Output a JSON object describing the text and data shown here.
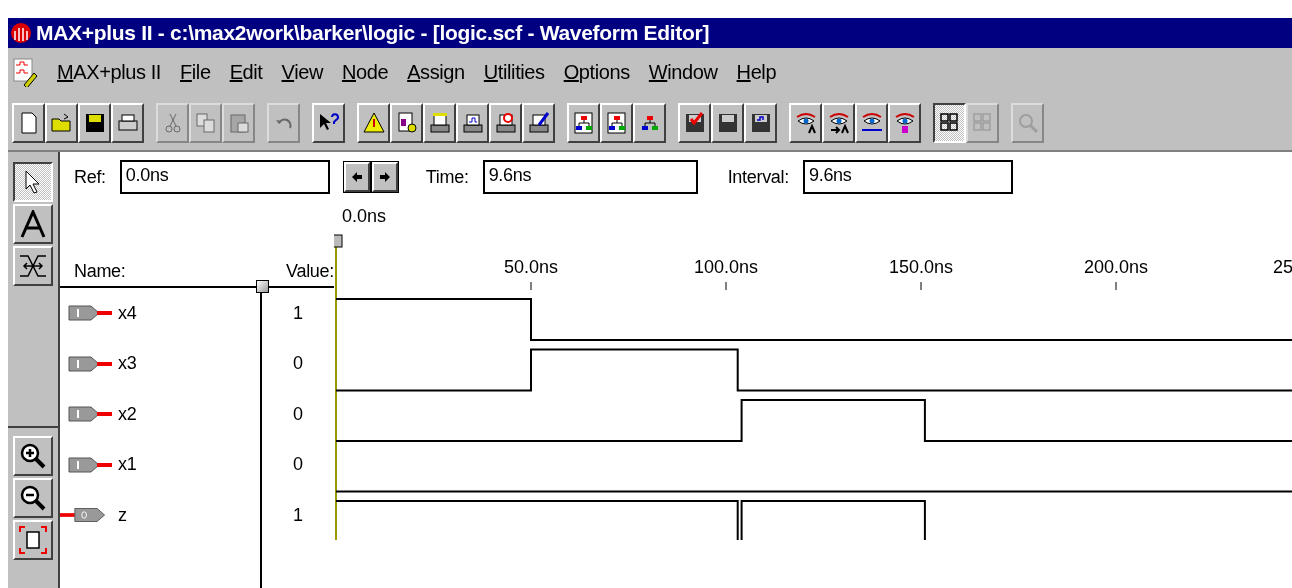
{
  "window": {
    "title": "MAX+plus II - c:\\max2work\\barker\\logic - [logic.scf - Waveform Editor]"
  },
  "menu": [
    {
      "label": "MAX+plus II"
    },
    {
      "label": "File"
    },
    {
      "label": "Edit"
    },
    {
      "label": "View"
    },
    {
      "label": "Node"
    },
    {
      "label": "Assign"
    },
    {
      "label": "Utilities"
    },
    {
      "label": "Options"
    },
    {
      "label": "Window"
    },
    {
      "label": "Help"
    }
  ],
  "toolbar": [
    [
      {
        "disabled": false,
        "pressed": false
      },
      {
        "disabled": false,
        "pressed": false
      },
      {
        "disabled": false,
        "pressed": false
      },
      {
        "disabled": false,
        "pressed": false
      }
    ],
    [
      {
        "disabled": true,
        "pressed": false
      },
      {
        "disabled": true,
        "pressed": false
      },
      {
        "disabled": true,
        "pressed": false
      }
    ],
    [
      {
        "disabled": true,
        "pressed": false
      }
    ],
    [
      {
        "disabled": false,
        "pressed": false
      }
    ],
    [
      {
        "disabled": false,
        "pressed": false
      },
      {
        "disabled": false,
        "pressed": false
      },
      {
        "disabled": false,
        "pressed": false
      },
      {
        "disabled": false,
        "pressed": false
      },
      {
        "disabled": false,
        "pressed": false
      },
      {
        "disabled": false,
        "pressed": false
      }
    ],
    [
      {
        "disabled": false,
        "pressed": false
      },
      {
        "disabled": false,
        "pressed": false
      },
      {
        "disabled": false,
        "pressed": false
      }
    ],
    [
      {
        "disabled": false,
        "pressed": false
      },
      {
        "disabled": false,
        "pressed": false
      },
      {
        "disabled": false,
        "pressed": false
      }
    ],
    [
      {
        "disabled": false,
        "pressed": false
      },
      {
        "disabled": false,
        "pressed": false
      },
      {
        "disabled": false,
        "pressed": false
      },
      {
        "disabled": false,
        "pressed": false
      }
    ],
    [
      {
        "disabled": false,
        "pressed": true
      },
      {
        "disabled": true,
        "pressed": false
      }
    ],
    [
      {
        "disabled": true,
        "pressed": false
      }
    ]
  ],
  "tools": [
    {
      "selected": true
    },
    {
      "selected": false
    },
    {
      "selected": false
    }
  ],
  "fields": [
    {
      "label": "Ref:",
      "value": "0.0ns"
    },
    {
      "label": "Time:",
      "value": "9.6ns"
    },
    {
      "label": "Interval:",
      "value": "9.6ns"
    }
  ],
  "cursor_label": "0.0ns",
  "columns": {
    "name": "Name:",
    "value": "Value:"
  },
  "time_ticks": [
    "50.0ns",
    "100.0ns",
    "150.0ns",
    "200.0ns",
    "25"
  ],
  "signals": [
    {
      "name": "x4",
      "kind": "input",
      "value": "1"
    },
    {
      "name": "x3",
      "kind": "input",
      "value": "0"
    },
    {
      "name": "x2",
      "kind": "input",
      "value": "0"
    },
    {
      "name": "x1",
      "kind": "input",
      "value": "0"
    },
    {
      "name": "z",
      "kind": "output",
      "value": "1"
    }
  ]
}
